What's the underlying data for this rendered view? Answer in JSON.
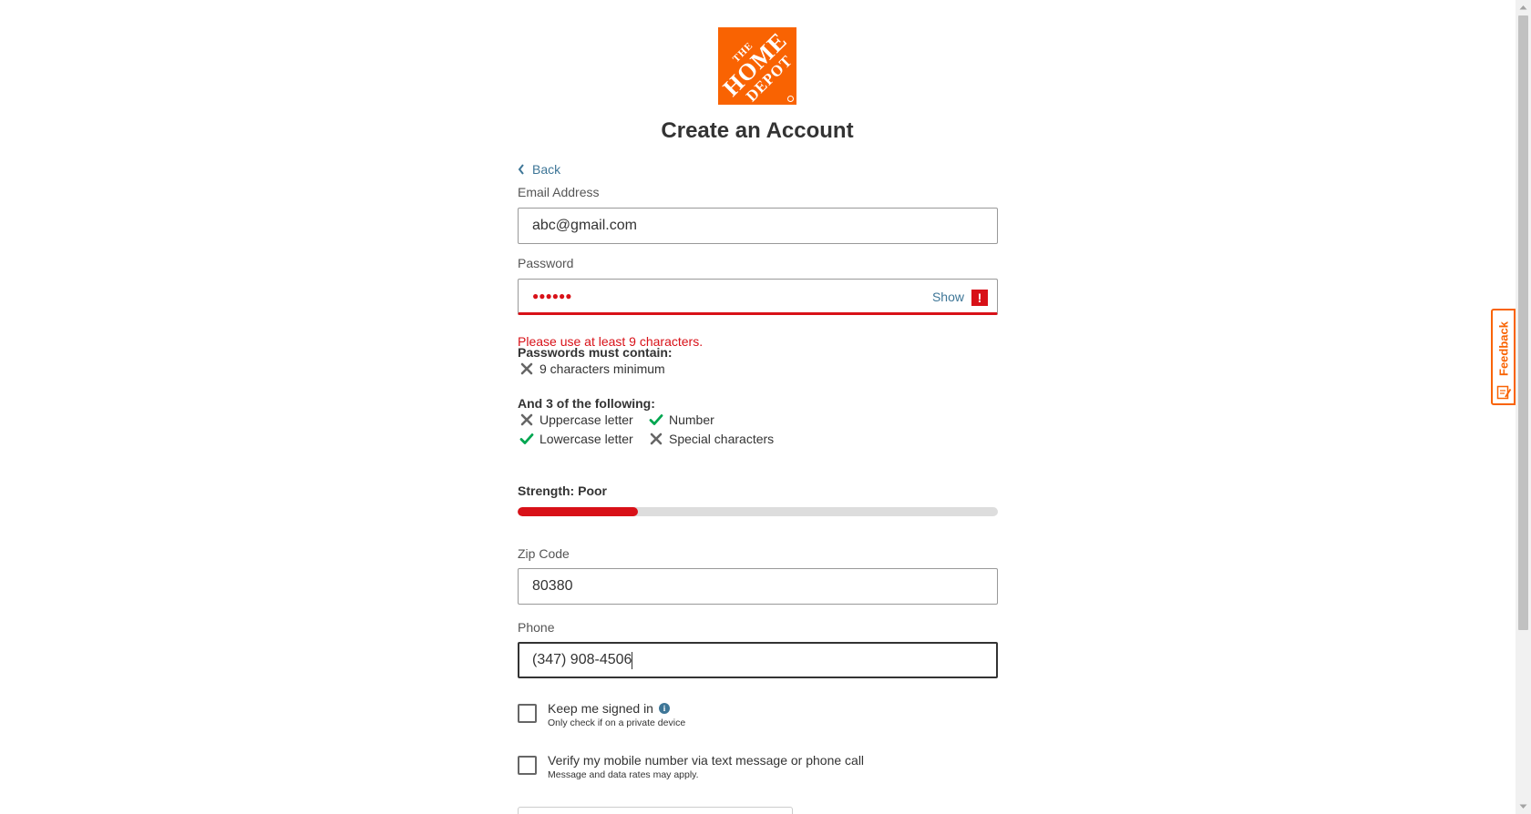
{
  "logo": {
    "line1": "THE",
    "line2": "HOME",
    "line3": "DEPOT",
    "brand_color": "#f96302"
  },
  "title": "Create an Account",
  "back": {
    "label": "Back",
    "icon": "chevron-left-icon"
  },
  "email": {
    "label": "Email Address",
    "value": "abc@gmail.com"
  },
  "password": {
    "label": "Password",
    "masked_value": "●●●●●●",
    "show_label": "Show",
    "error_icon": "!",
    "error_text": "Please use at least 9 characters."
  },
  "rules": {
    "must_title": "Passwords must contain:",
    "must_items": [
      {
        "text": "9 characters minimum",
        "met": false
      }
    ],
    "following_title": "And 3 of the following:",
    "following_items": [
      {
        "text": "Uppercase letter",
        "met": false
      },
      {
        "text": "Number",
        "met": true
      },
      {
        "text": "Lowercase letter",
        "met": true
      },
      {
        "text": "Special characters",
        "met": false
      }
    ],
    "met_color": "#00a650",
    "unmet_color": "#666666"
  },
  "strength": {
    "label": "Strength: Poor",
    "level_percent": 25,
    "color": "#d81118"
  },
  "zip": {
    "label": "Zip Code",
    "value": "80380"
  },
  "phone": {
    "label": "Phone",
    "value": "(347) 908-4506"
  },
  "keep_signed_in": {
    "label": "Keep me signed in",
    "sub": "Only check if on a private device",
    "checked": false
  },
  "verify_mobile": {
    "label": "Verify my mobile number via text message or phone call",
    "sub": "Message and data rates may apply.",
    "checked": false
  },
  "feedback": {
    "label": "Feedback",
    "color": "#f96302"
  }
}
